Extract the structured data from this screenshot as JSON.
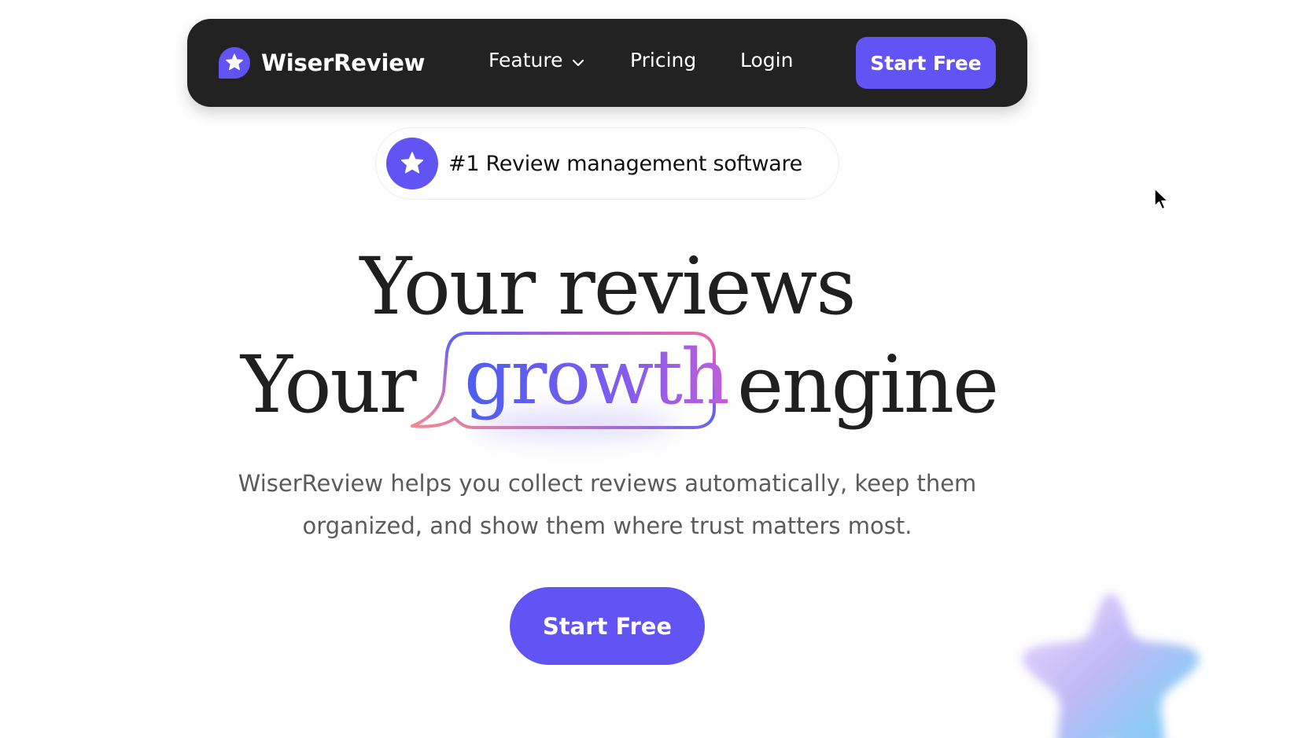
{
  "brand": {
    "name": "WiserReview",
    "logo_icon": "star-chat-icon",
    "accent_color": "#6253f5"
  },
  "nav": {
    "feature_label": "Feature",
    "feature_icon": "chevron-down-icon",
    "pricing_label": "Pricing",
    "login_label": "Login",
    "cta_label": "Start Free"
  },
  "badge": {
    "icon": "star-icon",
    "text": "#1 Review management software"
  },
  "hero": {
    "line1": "Your reviews",
    "line2_prefix": "Your",
    "line2_highlight": "growth",
    "line2_suffix": "engine",
    "subtitle": "WiserReview helps you collect reviews automatically, keep them organized, and show them where trust matters most.",
    "cta_label": "Start Free"
  },
  "decor": {
    "star_icon": "gradient-star-icon",
    "cursor_icon": "mouse-pointer-icon"
  }
}
